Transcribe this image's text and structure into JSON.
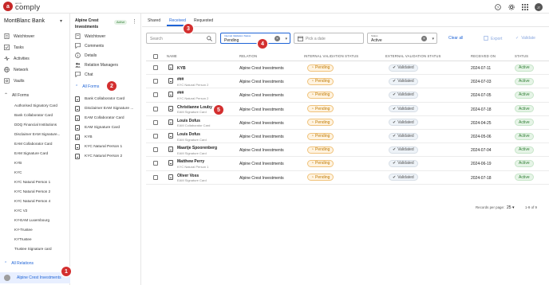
{
  "app": {
    "logo_small": "amnis",
    "logo_text": "comply",
    "logo_letter": "a"
  },
  "topbar": {
    "avatar_initials": "JT"
  },
  "sidebar": {
    "company": "MontBlanc Bank",
    "nav": [
      {
        "label": "Watchtower",
        "icon": "watchtower-icon"
      },
      {
        "label": "Tasks",
        "icon": "tasks-icon"
      },
      {
        "label": "Activities",
        "icon": "activities-icon"
      },
      {
        "label": "Network",
        "icon": "network-icon"
      },
      {
        "label": "Vaults",
        "icon": "vault-icon"
      }
    ],
    "all_forms_label": "All Forms",
    "forms": [
      "Authorised Signatory Card",
      "Bank Collaborator Card",
      "DDQ Financial Institutions",
      "Disclaimer EAM Signature...",
      "EAM Collaborator Card",
      "EAM Signature Card",
      "KYB",
      "KYC",
      "KYC Natural Person 1",
      "KYC Natural Person 2",
      "KYC Natural Person 4",
      "KYC V2",
      "KY-EAM Luxembourg",
      "KY-Trustee",
      "KYTrustee",
      "Trustee Signature card"
    ],
    "all_relations_label": "All Relations",
    "selected_relation": "Alpine Crest Investments"
  },
  "sidebar2": {
    "title": "Alpine Crest Investments",
    "badge": "Active",
    "items": [
      "Watchtower",
      "Comments",
      "Details",
      "Relation Managers",
      "Chat"
    ],
    "all_forms_label": "All Forms",
    "forms": [
      "Bank Collaborator Card",
      "Disclaimer EAM Signature ...",
      "EAM Collaborator Card",
      "EAM Signature Card",
      "KYB",
      "KYC Natural Person 1",
      "KYC Natural Person 2"
    ]
  },
  "main": {
    "tabs": [
      "Shared",
      "Received",
      "Requested"
    ],
    "active_tab": "Received",
    "search_placeholder": "Search",
    "internal_filter": {
      "label": "Internal Validation Status",
      "value": "Pending"
    },
    "date_placeholder": "Pick a date",
    "status_filter": {
      "label": "Status",
      "value": "Active"
    },
    "clear_all": "Clear all",
    "export": "Export",
    "validate": "Validate",
    "columns": [
      "NAME",
      "RELATION",
      "INTERNAL VALIDATION STATUS",
      "EXTERNAL VALIDATION STATUS",
      "RECEIVED ON",
      "STATUS"
    ],
    "rows": [
      {
        "name": "KYB",
        "sub": "",
        "relation": "Alpine Crest Investments",
        "internal": "Pending",
        "external": "Validated",
        "date": "2024-07-11",
        "status": "Active"
      },
      {
        "name": "###",
        "sub": "KYC Natural Person 2",
        "relation": "Alpine Crest Investments",
        "internal": "Pending",
        "external": "Validated",
        "date": "2024-07-03",
        "status": "Active"
      },
      {
        "name": "###",
        "sub": "KYC Natural Person 2",
        "relation": "Alpine Crest Investments",
        "internal": "Pending",
        "external": "Validated",
        "date": "2024-07-05",
        "status": "Active"
      },
      {
        "name": "Christianne Louby",
        "sub": "EAM Signature Card",
        "relation": "Alpine Crest Investments",
        "internal": "Pending",
        "external": "Validated",
        "date": "2024-07-18",
        "status": "Active"
      },
      {
        "name": "Louis Dofus",
        "sub": "EAM Collaborator Card",
        "relation": "Alpine Crest Investments",
        "internal": "Pending",
        "external": "Validated",
        "date": "2024-04-25",
        "status": "Active"
      },
      {
        "name": "Louis Dofus",
        "sub": "EAM Signature Card",
        "relation": "Alpine Crest Investments",
        "internal": "Pending",
        "external": "Validated",
        "date": "2024-05-06",
        "status": "Active"
      },
      {
        "name": "Maartje Spoorenberg",
        "sub": "EAM Signature Card",
        "relation": "Alpine Crest Investments",
        "internal": "Pending",
        "external": "Validated",
        "date": "2024-07-04",
        "status": "Active"
      },
      {
        "name": "Matthew Perry",
        "sub": "KYC Natural Person 1",
        "relation": "Alpine Crest Investments",
        "internal": "Pending",
        "external": "Validated",
        "date": "2024-06-19",
        "status": "Active"
      },
      {
        "name": "Oliver Voss",
        "sub": "EAM Signature Card",
        "relation": "Alpine Crest Investments",
        "internal": "Pending",
        "external": "Validated",
        "date": "2024-07-18",
        "status": "Active"
      }
    ],
    "pager": {
      "rows_per_page_label": "Records per page:",
      "rows_per_page": "25",
      "range": "1-9 of 9"
    }
  },
  "markers": [
    "1",
    "2",
    "3",
    "4",
    "5"
  ],
  "colors": {
    "accent": "#1e63d6",
    "marker": "#d32f2f",
    "brand": "#c62828"
  }
}
